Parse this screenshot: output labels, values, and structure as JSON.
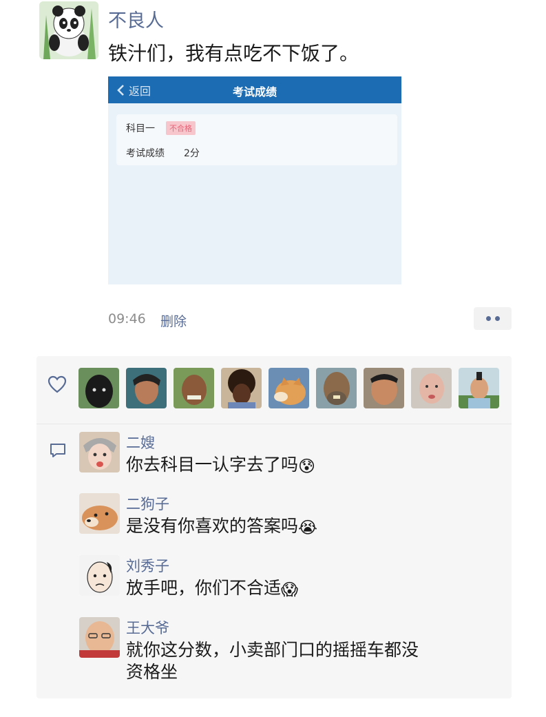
{
  "post": {
    "author": "不良人",
    "text": "铁汁们，我有点吃不下饭了。",
    "time": "09:46",
    "delete_label": "删除"
  },
  "embed": {
    "back_label": "返回",
    "title": "考试成绩",
    "subject": "科目一",
    "badge": "不合格",
    "score_label": "考试成绩",
    "score_value": "2分"
  },
  "likes": {
    "icon": "heart-icon",
    "count_avatars": 9
  },
  "comments": [
    {
      "name": "二嫂",
      "text": "你去科目一认字去了吗",
      "emoji": "😰"
    },
    {
      "name": "二狗子",
      "text": "是没有你喜欢的答案吗",
      "emoji": "😭"
    },
    {
      "name": "刘秀子",
      "text": "放手吧，你们不合适",
      "emoji": "😱"
    },
    {
      "name": "王大爷",
      "text": "就你这分数，小卖部门口的摇摇车都没资格坐",
      "emoji": ""
    }
  ],
  "colors": {
    "link": "#576b95",
    "header_blue": "#1c6cb4",
    "panel_bg": "#f6f6f6",
    "fail_badge": "#f7c6cd"
  }
}
